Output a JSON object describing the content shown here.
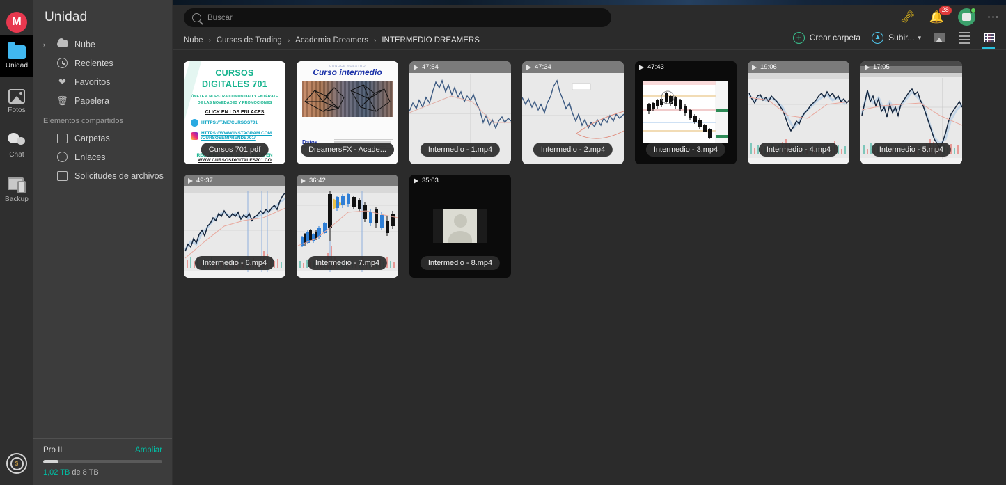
{
  "rail": {
    "logo": "M",
    "items": [
      {
        "label": "Unidad",
        "icon": "folder-icon",
        "active": true
      },
      {
        "label": "Fotos",
        "icon": "photo-icon",
        "active": false
      },
      {
        "label": "Chat",
        "icon": "chat-icon",
        "active": false
      },
      {
        "label": "Backup",
        "icon": "backup-icon",
        "active": false
      }
    ],
    "achievements_icon": "achievements-icon"
  },
  "sidebar": {
    "title": "Unidad",
    "items": [
      {
        "label": "Nube",
        "icon": "cloud-icon",
        "caret": "›"
      },
      {
        "label": "Recientes",
        "icon": "clock-icon",
        "caret": ""
      },
      {
        "label": "Favoritos",
        "icon": "heart-icon",
        "caret": ""
      },
      {
        "label": "Papelera",
        "icon": "trash-icon",
        "caret": ""
      }
    ],
    "section_label": "Elementos compartidos",
    "shared_items": [
      {
        "label": "Carpetas",
        "icon": "shared-folders-icon"
      },
      {
        "label": "Enlaces",
        "icon": "link-icon"
      },
      {
        "label": "Solicitudes de archivos",
        "icon": "file-request-icon"
      }
    ],
    "storage": {
      "plan": "Pro II",
      "upgrade_label": "Ampliar",
      "used": "1,02 TB",
      "used_of": "de 8 TB",
      "percent": 13
    }
  },
  "search": {
    "placeholder": "Buscar",
    "value": "",
    "icon": "search-icon"
  },
  "breadcrumb": {
    "items": [
      "Nube",
      "Cursos de Trading",
      "Academia Dreamers",
      "INTERMEDIO DREAMERS"
    ],
    "separator": "›"
  },
  "header_icons": {
    "key": "key-icon",
    "bell": "bell-icon",
    "notification_count": "28",
    "avatar": "avatar-icon",
    "menu": "kebab-menu-icon"
  },
  "actions": {
    "create_folder": "Crear carpeta",
    "upload": "Subir...",
    "upload_caret": "▾",
    "views": [
      {
        "name": "media-view-icon",
        "active": false
      },
      {
        "name": "list-view-icon",
        "active": false
      },
      {
        "name": "grid-view-icon",
        "active": true
      }
    ]
  },
  "colors": {
    "accent_teal": "#00bfa5",
    "accent_cyan": "#29c0de",
    "accent_green": "#39c28f",
    "badge_red": "#e03a3a",
    "logo_red": "#e8384f"
  },
  "files": [
    {
      "name": "Cursos 701.pdf",
      "type": "pdf",
      "duration": ""
    },
    {
      "name": "DreamersFX - Acade...",
      "type": "doc",
      "duration": ""
    },
    {
      "name": "Intermedio - 1.mp4",
      "type": "video-light",
      "duration": "47:54"
    },
    {
      "name": "Intermedio - 2.mp4",
      "type": "video-light",
      "duration": "47:34"
    },
    {
      "name": "Intermedio - 3.mp4",
      "type": "video-dark",
      "duration": "47:43"
    },
    {
      "name": "Intermedio - 4.mp4",
      "type": "video-candle",
      "duration": "19:06"
    },
    {
      "name": "Intermedio - 5.mp4",
      "type": "video-candle",
      "duration": "17:05"
    },
    {
      "name": "Intermedio - 6.mp4",
      "type": "video-candle",
      "duration": "49:37"
    },
    {
      "name": "Intermedio - 7.mp4",
      "type": "video-candle2",
      "duration": "36:42"
    },
    {
      "name": "Intermedio - 8.mp4",
      "type": "video-avatar",
      "duration": "35:03"
    }
  ],
  "pdf_thumb": {
    "title_line1": "CURSOS",
    "title_line2": "DIGITALES 701",
    "sub_line1": "ÚNETE A NUESTRA COMUNIDAD Y ENTÉRATE",
    "sub_line2": "DE LAS NOVEDADES Y PROMOCIONES",
    "cta": "CLICK EN LOS ENLACES",
    "link1": "HTTPS://T.ME/CURSOS701",
    "link2": "HTTPS://WWW.INSTAGRAM.COM",
    "link2b": "/CURSOSEMPRENDE701/",
    "footer1": "RECUERDA VER LOS CURSOS EN",
    "footer2": "WWW.CURSOSDIGITALES701.CO"
  },
  "doc_thumb": {
    "kicker": "CONOCE NUESTRO",
    "title": "Curso intermedio",
    "data_label1": "Datos",
    "data_label2": "del curso"
  }
}
